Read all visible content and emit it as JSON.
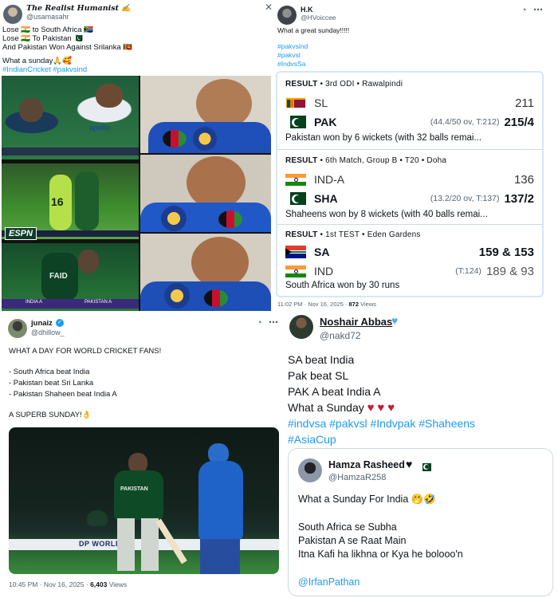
{
  "colors": {
    "link": "#1d9bf0",
    "muted": "#536471",
    "border": "#cfd9de",
    "heart": "#c21d3c",
    "verified": "#1d9bf0",
    "pitch_green": "#3f8e2e",
    "pak_green": "#01411c",
    "india_blue": "#1f63c9"
  },
  "tweet1": {
    "display_name": "The Realist Humanist ✍",
    "handle": "@usamasahr",
    "lines": [
      "Lose 🇮🇳 to South Africa 🇿🇦",
      "Lose 🇮🇳 To Pakistan 🇵🇰",
      "And Pakistan Won Against Srilanka 🇱🇰"
    ],
    "closing": "What a sunday🙏🥰",
    "hashtags": "#IndianCricket #pakvsind",
    "icon": "close-icon",
    "image_texts": {
      "jersey": "apollo",
      "logo": "ESPN",
      "jersey_name": "FAID",
      "scorebar1": "INDIA A",
      "scorebar2": "PAKISTAN A",
      "number": "16"
    }
  },
  "tweet2": {
    "display_name": "H.K",
    "handle": "@HVoiccee",
    "text": "What a great sunday!!!!!",
    "hashtags": [
      "#pakvsind",
      "#pakvsl",
      "#IndvsSa"
    ],
    "footer": {
      "time": "11:02 PM · Nov 16, 2025 ·",
      "views_count": "872",
      "views_label": "Views"
    },
    "results": [
      {
        "header_label": "RESULT",
        "header_info": "• 3rd ODI • Rawalpindi",
        "teams": [
          {
            "name": "SL",
            "flag": "sri-lanka-flag",
            "overs": "",
            "score": "211",
            "bold": false
          },
          {
            "name": "PAK",
            "flag": "pakistan-flag",
            "overs": "(44.4/50 ov, T:212)",
            "score": "215/4",
            "bold": true
          }
        ],
        "summary": "Pakistan won by 6 wickets (with 32 balls remai..."
      },
      {
        "header_label": "RESULT",
        "header_info": "• 6th Match, Group B • T20 • Doha",
        "teams": [
          {
            "name": "IND-A",
            "flag": "india-flag",
            "overs": "",
            "score": "136",
            "bold": false
          },
          {
            "name": "SHA",
            "flag": "pakistan-flag",
            "overs": "(13.2/20 ov, T:137)",
            "score": "137/2",
            "bold": true
          }
        ],
        "summary": "Shaheens won by 8 wickets (with 40 balls remai..."
      },
      {
        "header_label": "RESULT",
        "header_info": "• 1st TEST • Eden Gardens",
        "teams": [
          {
            "name": "SA",
            "flag": "south-africa-flag",
            "overs": "",
            "score": "159 & 153",
            "bold": true
          },
          {
            "name": "IND",
            "flag": "india-flag",
            "overs": "(T:124)",
            "score": "189 & 93",
            "bold": false
          }
        ],
        "summary": "South Africa won by 30 runs"
      }
    ]
  },
  "tweet3": {
    "display_name": "junaiz",
    "handle": "@dhillow_",
    "headline": "WHAT A DAY FOR WORLD CRICKET FANS!",
    "bullets": [
      "- South Africa beat India",
      "- Pakistan beat Sri Lanka",
      "- Pakistan Shaheen beat India A"
    ],
    "closing": "A SUPERB SUNDAY!👌",
    "image_texts": {
      "jersey": "PAKISTAN",
      "board": "DP WORLD"
    },
    "footer": {
      "time": "10:45 PM · Nov 16, 2025 ·",
      "views_count": "6,403",
      "views_label": "Views"
    }
  },
  "tweet4": {
    "display_name": "Noshair Abbas",
    "handle": "@nakd72",
    "lines": [
      "SA beat India",
      "Pak beat SL",
      "PAK A beat India A"
    ],
    "closing": "What a Sunday",
    "hashtags_line1": "#indvsa #pakvsl #Indvpak #Shaheens",
    "hashtags_line2": "#AsiaCup",
    "quoted": {
      "display_name": "Hamza Rasheed",
      "handle": "@HamzaR258",
      "first_line": "What a Sunday For India 🤭🤣",
      "lines": [
        "South Africa se Subha",
        "Pakistan A se Raat Main",
        "Itna Kafi ha likhna or Kya he bolooo'n"
      ],
      "mention": "@IrfanPathan"
    }
  }
}
